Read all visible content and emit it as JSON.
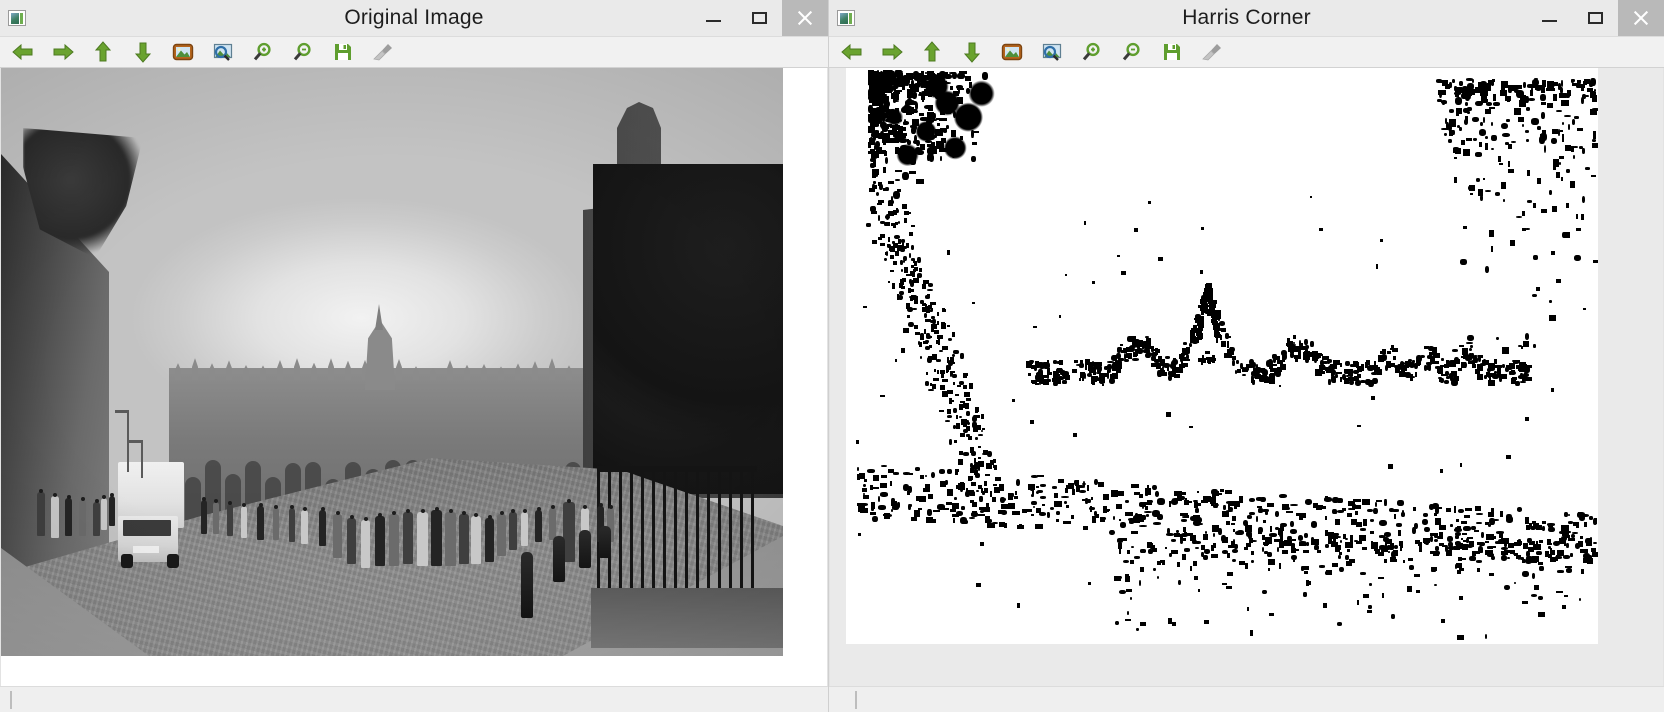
{
  "windows": [
    {
      "id": "original-image",
      "title": "Original Image",
      "icon": "image-window-icon",
      "controls": {
        "minimize": "–",
        "maximize": "▭",
        "close": "✕"
      },
      "toolbar": [
        {
          "name": "pan-left-button",
          "icon": "arrow-left-green-icon",
          "label": "Left"
        },
        {
          "name": "pan-right-button",
          "icon": "arrow-right-green-icon",
          "label": "Right"
        },
        {
          "name": "pan-up-button",
          "icon": "arrow-up-green-icon",
          "label": "Up"
        },
        {
          "name": "pan-down-button",
          "icon": "arrow-down-green-icon",
          "label": "Down"
        },
        {
          "name": "fit-image-button",
          "icon": "picture-icon",
          "label": "Fit Image"
        },
        {
          "name": "zoom-region-button",
          "icon": "picture-magnifier-icon",
          "label": "Zoom Region"
        },
        {
          "name": "zoom-in-button",
          "icon": "magnifier-plus-icon",
          "label": "Zoom In"
        },
        {
          "name": "zoom-out-button",
          "icon": "magnifier-minus-icon",
          "label": "Zoom Out"
        },
        {
          "name": "save-button",
          "icon": "floppy-disk-icon",
          "label": "Save"
        },
        {
          "name": "clear-button",
          "icon": "broom-icon",
          "label": "Clear",
          "disabled": true
        }
      ],
      "canvas": {
        "name": "original-photo-canvas",
        "content": "greyscale street photograph of Cambridge King's Parade with a white box van, pedestrians and college chapel"
      },
      "scrollbar": {
        "name": "horizontal-scrollbar",
        "orientation": "horizontal"
      }
    },
    {
      "id": "harris-corner",
      "title": "Harris Corner",
      "icon": "image-window-icon",
      "controls": {
        "minimize": "–",
        "maximize": "▭",
        "close": "✕"
      },
      "toolbar": [
        {
          "name": "pan-left-button",
          "icon": "arrow-left-green-icon",
          "label": "Left"
        },
        {
          "name": "pan-right-button",
          "icon": "arrow-right-green-icon",
          "label": "Right"
        },
        {
          "name": "pan-up-button",
          "icon": "arrow-up-green-icon",
          "label": "Up"
        },
        {
          "name": "pan-down-button",
          "icon": "arrow-down-green-icon",
          "label": "Down"
        },
        {
          "name": "fit-image-button",
          "icon": "picture-icon",
          "label": "Fit Image"
        },
        {
          "name": "zoom-region-button",
          "icon": "picture-magnifier-icon",
          "label": "Zoom Region"
        },
        {
          "name": "zoom-in-button",
          "icon": "magnifier-plus-icon",
          "label": "Zoom In"
        },
        {
          "name": "zoom-out-button",
          "icon": "magnifier-minus-icon",
          "label": "Zoom Out"
        },
        {
          "name": "save-button",
          "icon": "floppy-disk-icon",
          "label": "Save"
        },
        {
          "name": "clear-button",
          "icon": "broom-icon",
          "label": "Clear",
          "disabled": true
        }
      ],
      "canvas": {
        "name": "harris-corner-canvas",
        "content": "binary black-on-white Harris corner response map of the same street scene"
      },
      "scrollbar": {
        "name": "horizontal-scrollbar",
        "orientation": "horizontal"
      }
    }
  ],
  "colors": {
    "titlebar_bg": "#eaeaea",
    "toolbar_bg": "#f1f1f1",
    "close_btn_bg": "#b9b9b9",
    "title_text": "#1d1d1d",
    "arrow_green": "#6aa32f",
    "save_green": "#5f9e2f",
    "canvas_bg": "#ffffff",
    "corner_dot": "#000000"
  }
}
